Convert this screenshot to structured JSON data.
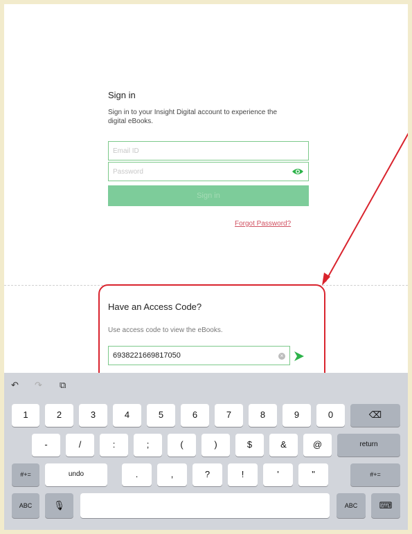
{
  "signin": {
    "title": "Sign in",
    "description": "Sign in to your Insight Digital account to experience the digital eBooks.",
    "email_placeholder": "Email ID",
    "password_placeholder": "Password",
    "button_label": "Sign in",
    "forgot_label": "Forgot Password?"
  },
  "access": {
    "title": "Have an Access Code?",
    "description": "Use access code to view the eBooks.",
    "code_value": "6938221669817050"
  },
  "keyboard": {
    "toolbar": {
      "undo_icon": "↶",
      "redo_icon": "↷",
      "paste_icon": "⧉"
    },
    "row1": [
      "1",
      "2",
      "3",
      "4",
      "5",
      "6",
      "7",
      "8",
      "9",
      "0"
    ],
    "delete_icon": "⌫",
    "row2": [
      "-",
      "/",
      ":",
      ";",
      "(",
      ")",
      "$",
      "&",
      "@"
    ],
    "return_label": "return",
    "row3_mode": "#+=",
    "undo_label": "undo",
    "row3": [
      ".",
      ",",
      "?",
      "!",
      "'",
      "\""
    ],
    "row4_abc": "ABC",
    "mic_icon": "🎙",
    "hide_icon": "⌨"
  },
  "colors": {
    "accent_green": "#7dcc9a",
    "highlight_red": "#d9232d",
    "link_red": "#d05060"
  }
}
